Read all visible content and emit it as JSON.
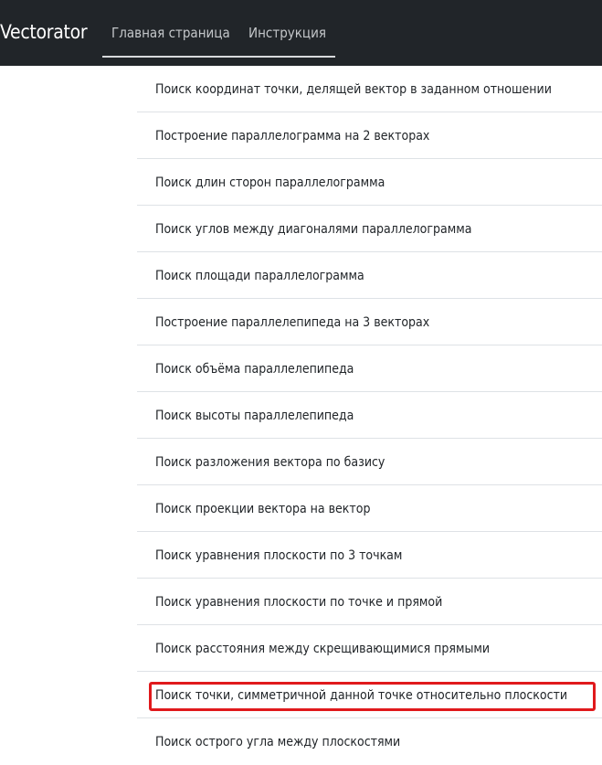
{
  "navbar": {
    "brand": "Vectorator",
    "links": [
      "Главная страница",
      "Инструкция"
    ]
  },
  "list_items": [
    "Поиск координат точки, делящей вектор в заданном отношении",
    "Построение параллелограмма на 2 векторах",
    "Поиск длин сторон параллелограмма",
    "Поиск углов между диагоналями параллелограмма",
    "Поиск площади параллелограмма",
    "Построение параллелепипеда на 3 векторах",
    "Поиск объёма параллелепипеда",
    "Поиск высоты параллелепипеда",
    "Поиск разложения вектора по базису",
    "Поиск проекции вектора на вектор",
    "Поиск уравнения плоскости по 3 точкам",
    "Поиск уравнения плоскости по точке и прямой",
    "Поиск расстояния между скрещивающимися прямыми",
    "Поиск точки, симметричной данной точке относительно плоскости",
    "Поиск острого угла между плоскостями"
  ],
  "highlighted_item": "Поиск точки, симметричной данной точке относительно плоскости",
  "colors": {
    "navbar_bg": "#212529",
    "highlight_border": "#e0191c"
  }
}
